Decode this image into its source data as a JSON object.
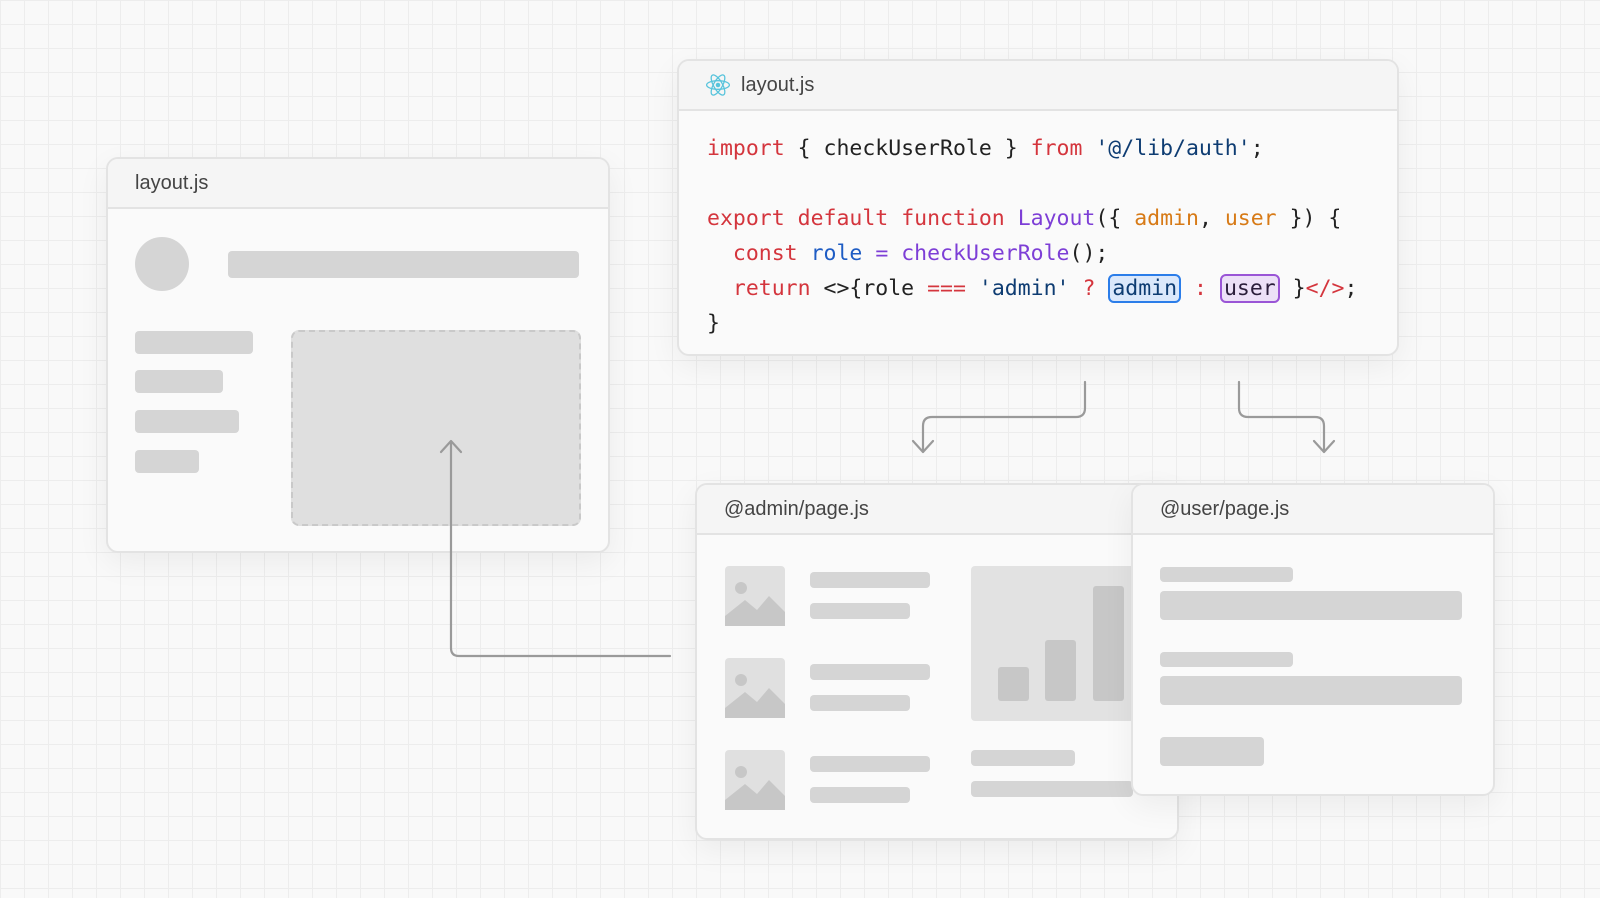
{
  "left_card": {
    "title": "layout.js"
  },
  "code_card": {
    "title": "layout.js",
    "icon": "react-icon",
    "lines": {
      "l1": {
        "import": "import",
        "open": " { checkUserRole } ",
        "from": "from",
        "sp": " ",
        "path": "'@/lib/auth'",
        "end": ";"
      },
      "l3": {
        "export": "export",
        "default": "default",
        "function": "function",
        "name": "Layout",
        "open": "({ ",
        "p1": "admin",
        "comma": ", ",
        "p2": "user",
        "close": " }) {"
      },
      "l4": {
        "const": "const",
        "role": "role",
        "eq": "=",
        "call": "checkUserRole",
        "end": "();"
      },
      "l5": {
        "return": "return",
        "frag": "<>{role ",
        "eqeq": "===",
        "str": "'admin'",
        "q": "?",
        "admin": "admin",
        "colon": ":",
        "user": "user",
        "close1": "}",
        "fragclose": "</>",
        "end": ";"
      },
      "l6": {
        "brace": "}"
      }
    }
  },
  "admin_card": {
    "title": "@admin/page.js"
  },
  "user_card": {
    "title": "@user/page.js"
  },
  "colors": {
    "admin_highlight": "#2b7de9",
    "user_highlight": "#9a55d6",
    "placeholder": "#d5d5d5"
  }
}
